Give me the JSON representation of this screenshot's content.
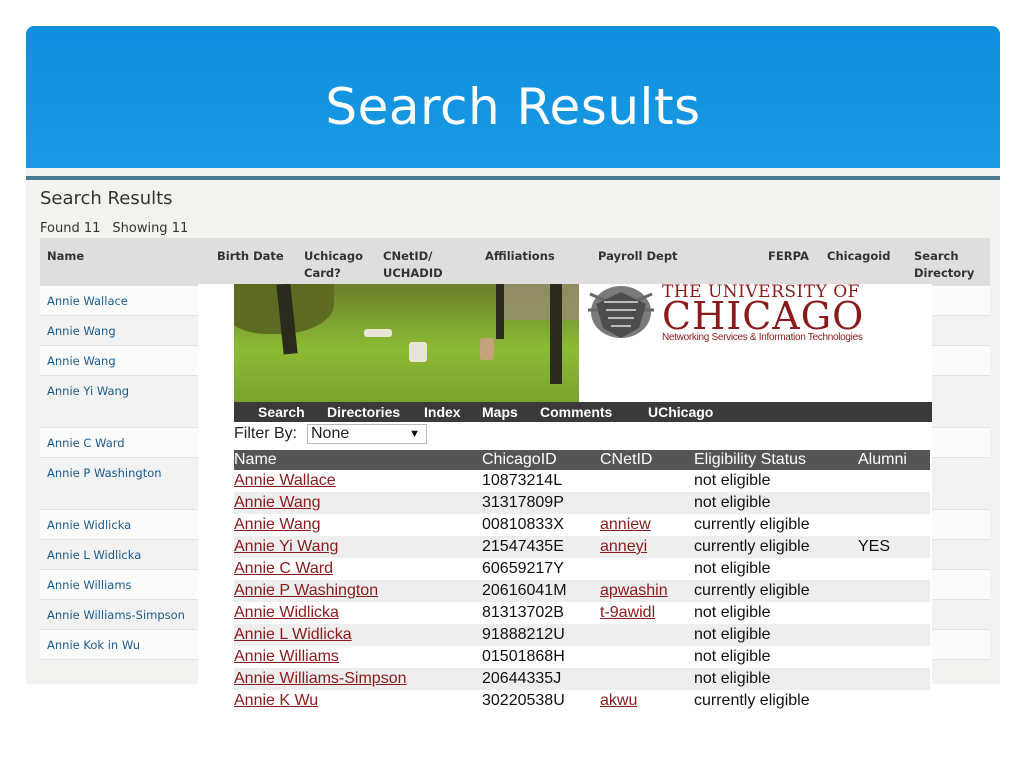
{
  "slide": {
    "title": "Search Results"
  },
  "background": {
    "heading": "Search Results",
    "found": "Found 11",
    "showing": "Showing 11",
    "columns": [
      "Name",
      "Birth Date",
      "Uchicago Card?",
      "CNetID/ UCHADID",
      "Affiliations",
      "Payroll Dept",
      "FERPA",
      "Chicagoid",
      "Search Directory"
    ],
    "names": [
      "Annie Wallace",
      "Annie Wang",
      "Annie Wang",
      "Annie Yi Wang",
      "Annie C Ward",
      "Annie P Washington",
      "Annie Widlicka",
      "Annie L Widlicka",
      "Annie Williams",
      "Annie Williams-Simpson",
      "Annie Kok in Wu"
    ]
  },
  "overlay": {
    "logo": {
      "line1": "THE UNIVERSITY OF",
      "line2": "CHICAGO",
      "line3": "Networking Services & Information Technologies"
    },
    "nav": [
      "Search",
      "Directories",
      "Index",
      "Maps",
      "Comments",
      "UChicago"
    ],
    "filter": {
      "label": "Filter By:",
      "value": "None"
    },
    "columns": [
      "Name",
      "ChicagoID",
      "CNetID",
      "Eligibility Status",
      "Alumni"
    ],
    "rows": [
      {
        "name": "Annie Wallace",
        "chicagoid": "10873214L",
        "cnetid": "",
        "status": "not eligible",
        "alumni": ""
      },
      {
        "name": "Annie Wang",
        "chicagoid": "31317809P",
        "cnetid": "",
        "status": "not eligible",
        "alumni": ""
      },
      {
        "name": "Annie Wang",
        "chicagoid": "00810833X",
        "cnetid": "anniew",
        "status": "currently eligible",
        "alumni": ""
      },
      {
        "name": "Annie Yi Wang",
        "chicagoid": "21547435E",
        "cnetid": "anneyi",
        "status": "currently eligible",
        "alumni": "YES"
      },
      {
        "name": "Annie C Ward",
        "chicagoid": "60659217Y",
        "cnetid": "",
        "status": "not eligible",
        "alumni": ""
      },
      {
        "name": "Annie P Washington",
        "chicagoid": "20616041M",
        "cnetid": "apwashin",
        "status": "currently eligible",
        "alumni": ""
      },
      {
        "name": "Annie Widlicka",
        "chicagoid": "81313702B",
        "cnetid": "t-9awidl",
        "status": "not eligible",
        "alumni": ""
      },
      {
        "name": "Annie L Widlicka",
        "chicagoid": "91888212U",
        "cnetid": "",
        "status": "not eligible",
        "alumni": ""
      },
      {
        "name": "Annie Williams",
        "chicagoid": "01501868H",
        "cnetid": "",
        "status": "not eligible",
        "alumni": ""
      },
      {
        "name": "Annie Williams-Simpson",
        "chicagoid": "20644335J",
        "cnetid": "",
        "status": "not eligible",
        "alumni": ""
      },
      {
        "name": "Annie K Wu",
        "chicagoid": "30220538U",
        "cnetid": "akwu",
        "status": "currently eligible",
        "alumni": ""
      }
    ]
  },
  "colors": {
    "banner": "#1a9ae4",
    "uc_maroon": "#8b1a1a",
    "navbar": "#3a3a3a",
    "table_header": "#555555"
  }
}
